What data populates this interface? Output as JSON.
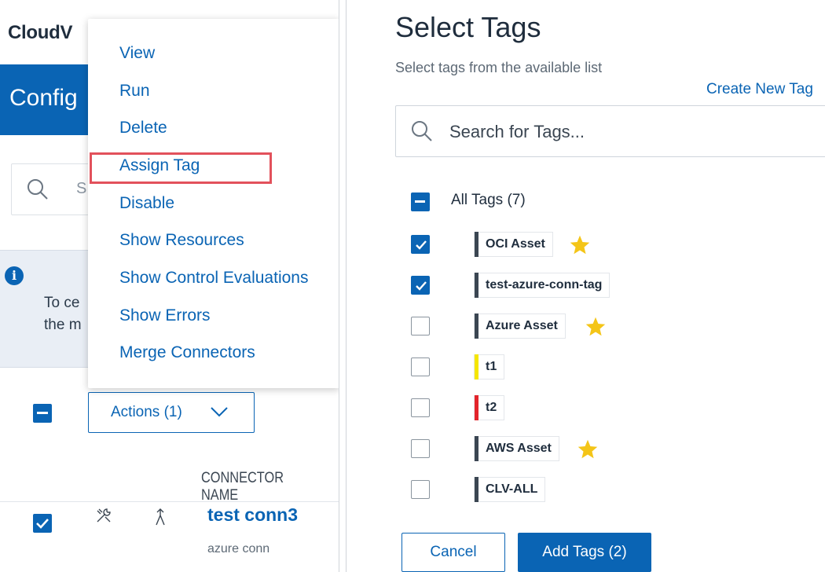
{
  "left": {
    "app_title": "CloudV",
    "banner_title": "Config",
    "search_placeholder": "S",
    "info_text_line1": "To ce",
    "info_text_line2": "the m",
    "actions_label": "Actions (1)",
    "column_header": "CONNECTOR NAME",
    "row": {
      "name": "test conn3",
      "description": "azure conn"
    },
    "menu": {
      "items": [
        "View",
        "Run",
        "Delete",
        "Assign Tag",
        "Disable",
        "Show Resources",
        "Show Control Evaluations",
        "Show Errors",
        "Merge Connectors"
      ],
      "highlighted": "Assign Tag"
    }
  },
  "dialog": {
    "title": "Select Tags",
    "subtitle": "Select tags from the available list",
    "create_link": "Create New Tag",
    "search_placeholder": "Search for Tags...",
    "all_tags_label": "All Tags (7)",
    "tags": [
      {
        "name": "OCI Asset",
        "checked": true,
        "color": "#3b4652",
        "starred": true
      },
      {
        "name": "test-azure-conn-tag",
        "checked": true,
        "color": "#3b4652",
        "starred": false
      },
      {
        "name": "Azure Asset",
        "checked": false,
        "color": "#3b4652",
        "starred": true
      },
      {
        "name": "t1",
        "checked": false,
        "color": "#f5e600",
        "starred": false
      },
      {
        "name": "t2",
        "checked": false,
        "color": "#e3242b",
        "starred": false
      },
      {
        "name": "AWS Asset",
        "checked": false,
        "color": "#3b4652",
        "starred": true
      },
      {
        "name": "CLV-ALL",
        "checked": false,
        "color": "#3b4652",
        "starred": false
      }
    ],
    "cancel_label": "Cancel",
    "add_label": "Add Tags (2)"
  },
  "colors": {
    "accent": "#0a64b4",
    "highlight": "#e2515b",
    "star": "#f4c518"
  },
  "icons": [
    "search-icon",
    "info-icon",
    "chevron-down-icon",
    "tools-icon",
    "merge-icon",
    "check-icon",
    "star-icon"
  ]
}
